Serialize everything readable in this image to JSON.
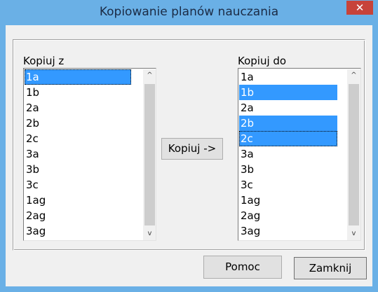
{
  "window": {
    "title": "Kopiowanie planów nauczania",
    "close_glyph": "✕"
  },
  "source": {
    "label": "Kopiuj z",
    "items": [
      "1a",
      "1b",
      "2a",
      "2b",
      "2c",
      "3a",
      "3b",
      "3c",
      "1ag",
      "2ag",
      "3ag"
    ],
    "selected": [
      "1a"
    ]
  },
  "target": {
    "label": "Kopiuj do",
    "items": [
      "1a",
      "1b",
      "2a",
      "2b",
      "2c",
      "3a",
      "3b",
      "3c",
      "1ag",
      "2ag",
      "3ag"
    ],
    "selected": [
      "1b",
      "2b",
      "2c"
    ]
  },
  "buttons": {
    "copy": "Kopiuj ->",
    "help": "Pomoc",
    "close": "Zamknij"
  },
  "icons": {
    "scroll_up": "^",
    "scroll_down": "v"
  },
  "colors": {
    "title_bar": "#6ab0e6",
    "close_button": "#c7433a",
    "selection": "#3399ff"
  }
}
